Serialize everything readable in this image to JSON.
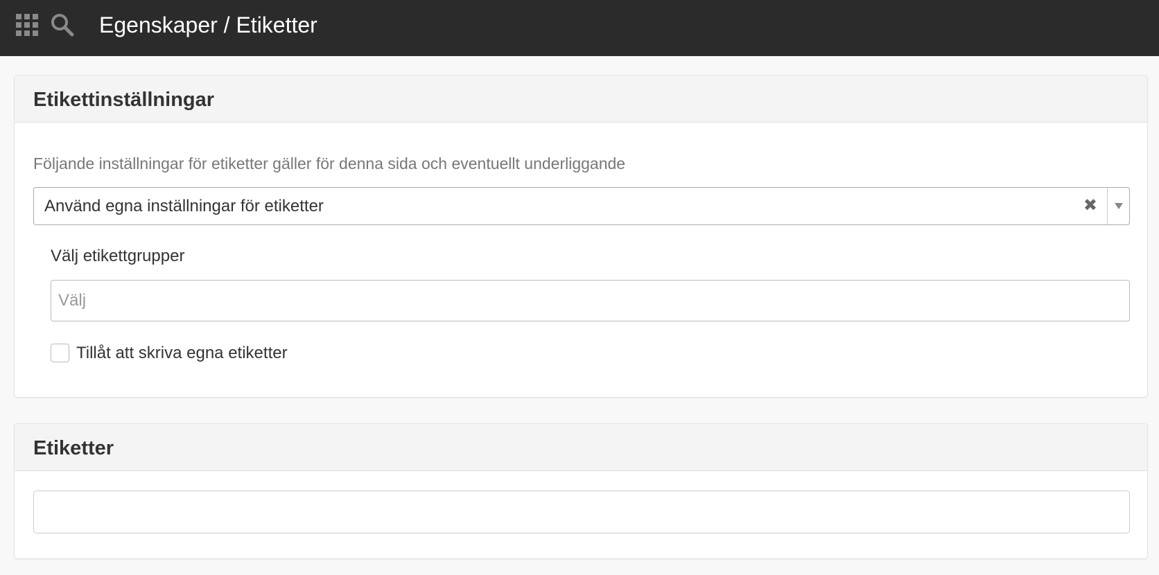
{
  "header": {
    "title": "Egenskaper / Etiketter",
    "apps_icon": "grid-icon",
    "search_icon": "search-icon",
    "background": "#2b2b2b"
  },
  "label_settings": {
    "title": "Etikettinställningar",
    "help_text": "Följande inställningar för etiketter gäller för denna sida och eventuellt underliggande",
    "mode_select": {
      "selected": "Använd egna inställningar för etiketter",
      "clear_symbol": "✖"
    },
    "groups": {
      "label": "Välj etikettgrupper",
      "placeholder": "Välj",
      "value": ""
    },
    "allow_custom": {
      "label": "Tillåt att skriva egna etiketter",
      "checked": false
    }
  },
  "labels": {
    "title": "Etiketter",
    "value": ""
  }
}
